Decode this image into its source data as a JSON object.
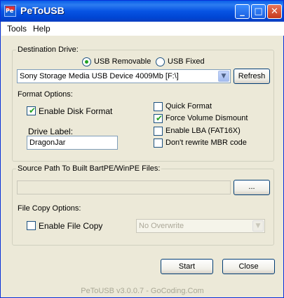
{
  "window": {
    "title": "PeToUSB",
    "icon_text": "Pe"
  },
  "title_buttons": {
    "minimize": "_",
    "maximize": "□",
    "close": "✕"
  },
  "menu": [
    "Tools",
    "Help"
  ],
  "destination": {
    "group_label": "Destination Drive:",
    "radio_removable": "USB Removable",
    "radio_fixed": "USB Fixed",
    "selected": "removable",
    "drive": "Sony Storage Media USB Device 4009Mb [F:\\]",
    "refresh": "Refresh"
  },
  "format": {
    "group_label": "Format Options:",
    "enable_disk_format": "Enable Disk Format",
    "drive_label_caption": "Drive Label:",
    "drive_label_value": "DragonJar",
    "quick_format": "Quick Format",
    "force_volume_dismount": "Force Volume Dismount",
    "enable_lba": "Enable LBA (FAT16X)",
    "dont_rewrite_mbr": "Don't rewrite MBR code",
    "checked": {
      "enable_disk_format": true,
      "quick_format": false,
      "force_volume_dismount": true,
      "enable_lba": false,
      "dont_rewrite_mbr": false
    }
  },
  "source": {
    "group_label": "Source Path To Built BartPE/WinPE Files:",
    "path": "",
    "browse": "...",
    "file_copy_label": "File Copy Options:",
    "enable_file_copy": "Enable File Copy",
    "overwrite_option": "No Overwrite",
    "checked": {
      "enable_file_copy": false
    }
  },
  "actions": {
    "start": "Start",
    "close": "Close"
  },
  "footer": "PeToUSB v3.0.0.7 - GoCoding.Com"
}
